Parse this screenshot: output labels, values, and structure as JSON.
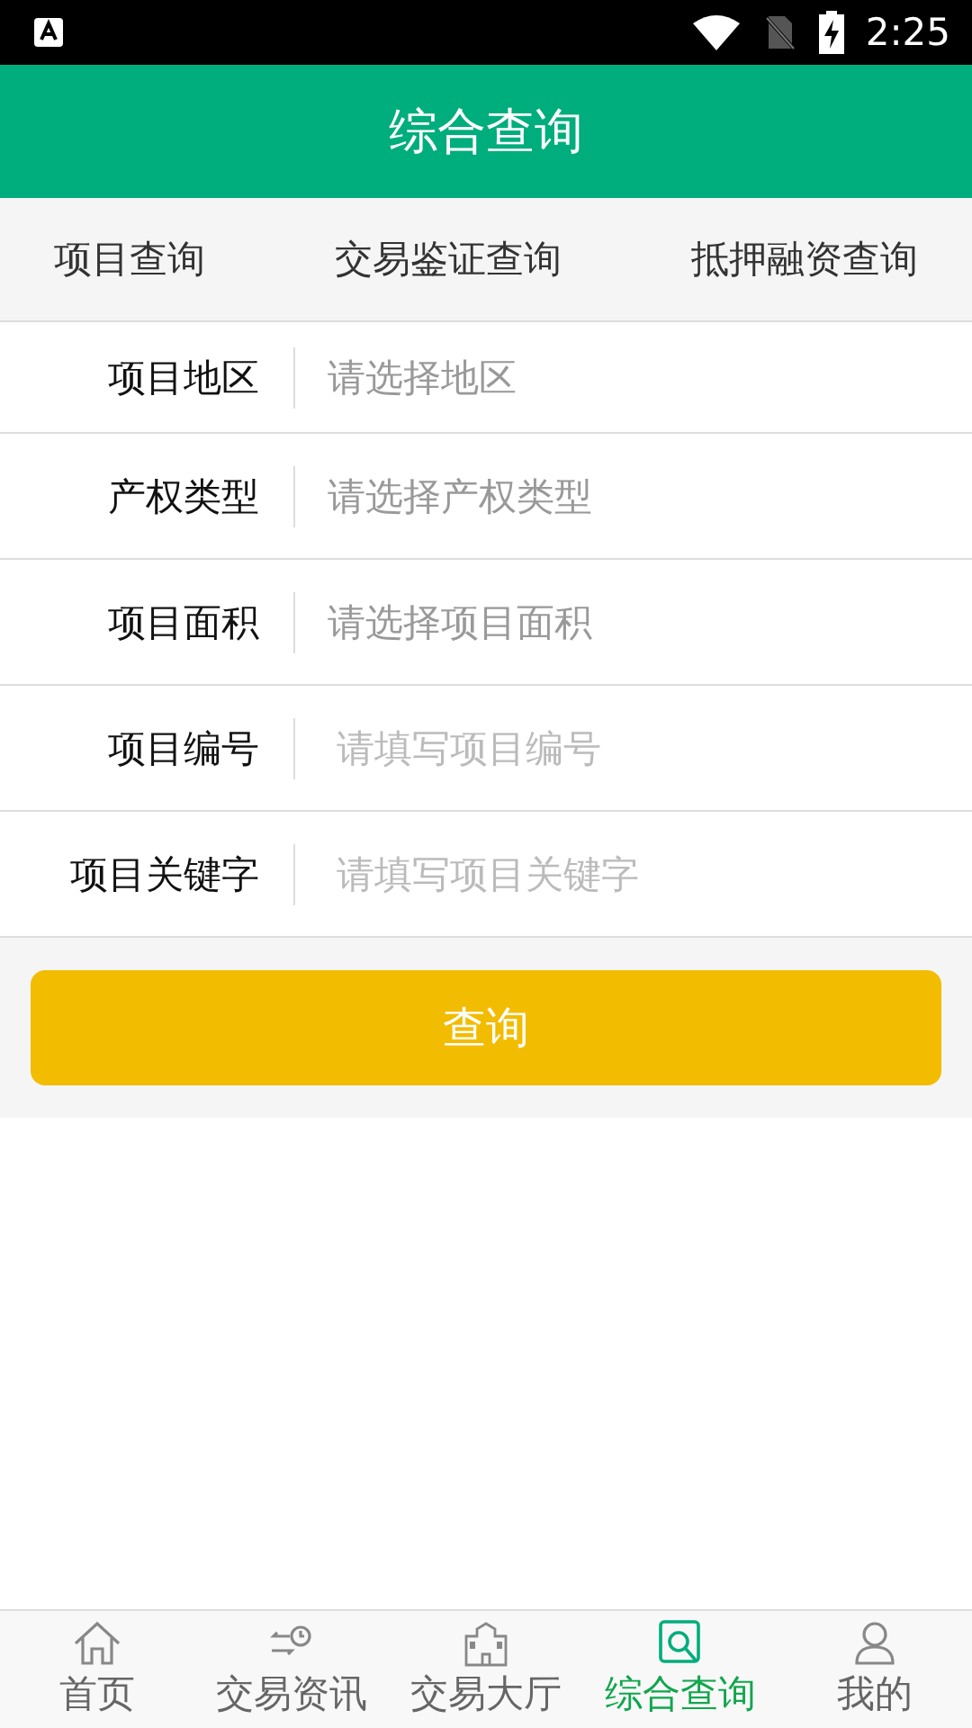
{
  "status_bar": {
    "time": "2:25"
  },
  "header": {
    "title": "综合查询"
  },
  "tabs": [
    {
      "label": "项目查询"
    },
    {
      "label": "交易鉴证查询"
    },
    {
      "label": "抵押融资查询"
    }
  ],
  "form": [
    {
      "label": "项目地区",
      "kind": "select",
      "placeholder": "请选择地区"
    },
    {
      "label": "产权类型",
      "kind": "select",
      "placeholder": "请选择产权类型"
    },
    {
      "label": "项目面积",
      "kind": "select",
      "placeholder": "请选择项目面积"
    },
    {
      "label": "项目编号",
      "kind": "input",
      "placeholder": "请填写项目编号"
    },
    {
      "label": "项目关键字",
      "kind": "input",
      "placeholder": "请填写项目关键字"
    }
  ],
  "submit_button": "查询",
  "bottom_nav": [
    {
      "label": "首页",
      "selected": false
    },
    {
      "label": "交易资讯",
      "selected": false
    },
    {
      "label": "交易大厅",
      "selected": false
    },
    {
      "label": "综合查询",
      "selected": true
    },
    {
      "label": "我的",
      "selected": false
    }
  ]
}
